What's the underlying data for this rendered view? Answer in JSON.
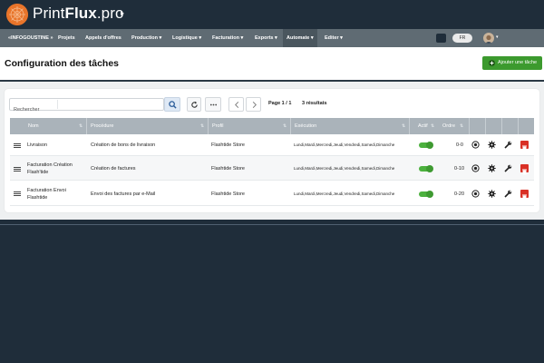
{
  "brand": {
    "name_light": "Print",
    "name_bold": "Flux",
    "name_suffix": ".pro",
    "caret": "▸",
    "logo_color": "#e8742a"
  },
  "menu": {
    "items": [
      {
        "label": "«INFOGOUSTINE »"
      },
      {
        "label": "Projets"
      },
      {
        "label": "Appels d'offres"
      },
      {
        "label": "Production ▾"
      },
      {
        "label": "Logistique ▾"
      },
      {
        "label": "Facturation ▾"
      },
      {
        "label": "Exports ▾"
      },
      {
        "label": "Automate ▾",
        "active": true
      },
      {
        "label": "Editer ▾"
      }
    ],
    "language": "FR",
    "bar_color": "#5f6b73"
  },
  "page": {
    "title": "Configuration des tâches",
    "add_button": "Ajouter une tâche",
    "accent": "#3c9a2e"
  },
  "toolbar": {
    "search_label": "Rechercher",
    "search_value": "",
    "pager": "Page 1 / 1",
    "results": "3 résultats"
  },
  "table": {
    "headers": {
      "nom": "Nom",
      "procedure": "Procédure",
      "profil": "Profil",
      "execution": "Exécution",
      "actif": "Actif",
      "ordre": "Ordre"
    },
    "rows": [
      {
        "nom": "Livraison",
        "procedure": "Création de bons de livraison",
        "profil": "Flashtide Store",
        "execution": "Lundi,Mardi,Mercredi,Jeudi,Vendredi,Samedi,Dimanche",
        "actif": true,
        "ordre": "0-0"
      },
      {
        "nom": "Facturation Création Flash'tide",
        "procedure": "Création de factures",
        "profil": "Flashtide Store",
        "execution": "Lundi,Mardi,Mercredi,Jeudi,Vendredi,Samedi,Dimanche",
        "actif": true,
        "ordre": "0-10"
      },
      {
        "nom": "Facturation Envoi Flashtide",
        "procedure": "Envoi des factures par e-Mail",
        "profil": "Flashtide Store",
        "execution": "Lundi,Mardi,Mercredi,Jeudi,Vendredi,Samedi,Dimanche",
        "actif": true,
        "ordre": "0-20"
      }
    ]
  }
}
